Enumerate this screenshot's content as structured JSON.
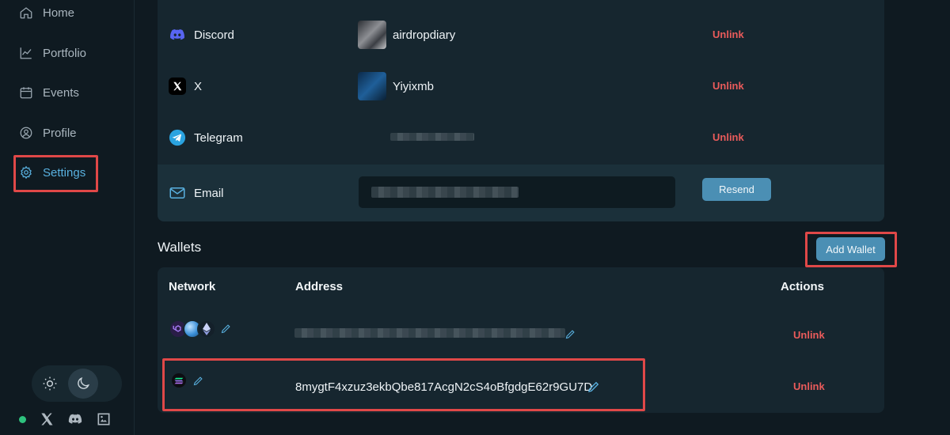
{
  "sidebar": {
    "items": [
      {
        "label": "Home",
        "icon": "home-icon"
      },
      {
        "label": "Portfolio",
        "icon": "chart-icon"
      },
      {
        "label": "Events",
        "icon": "calendar-icon"
      },
      {
        "label": "Profile",
        "icon": "user-icon"
      },
      {
        "label": "Settings",
        "icon": "gear-icon",
        "active": true
      }
    ],
    "theme": {
      "light_icon": "sun-icon",
      "dark_icon": "moon-icon",
      "selected": "dark"
    },
    "footer_icons": [
      "status-dot",
      "x-icon",
      "discord-icon",
      "gallery-icon"
    ]
  },
  "socials": [
    {
      "service": "Discord",
      "account": "airdropdiary",
      "action": "Unlink"
    },
    {
      "service": "X",
      "account": "Yiyixmb",
      "action": "Unlink"
    },
    {
      "service": "Telegram",
      "account": "",
      "action": "Unlink"
    }
  ],
  "email": {
    "service": "Email",
    "action": "Resend"
  },
  "wallets": {
    "title": "Wallets",
    "add_label": "Add Wallet",
    "columns": [
      "Network",
      "Address",
      "Actions"
    ],
    "rows": [
      {
        "networks": [
          "polygon",
          "sui",
          "ethereum"
        ],
        "address": "",
        "action": "Unlink"
      },
      {
        "networks": [
          "solana"
        ],
        "address": "8mygtF4xzuz3ekbQbe817AcgN2cS4oBfgdgE62r9GU7D",
        "action": "Unlink"
      }
    ]
  },
  "colors": {
    "accent": "#59b1e0",
    "danger": "#ea5b5b",
    "highlight": "#e04848",
    "button": "#4b8fb4"
  }
}
